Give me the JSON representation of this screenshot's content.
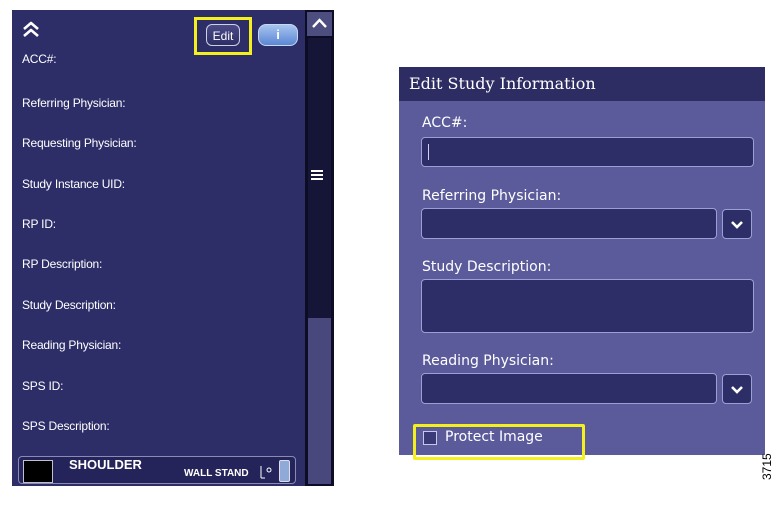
{
  "left_panel": {
    "edit_label": "Edit",
    "info_label": "i",
    "fields": [
      "ACC#:",
      "Referring Physician:",
      "Requesting Physician:",
      "Study Instance UID:",
      "RP ID:",
      "RP Description:",
      "Study Description:",
      "Reading Physician:",
      "SPS ID:",
      "SPS Description:"
    ],
    "thumbnail": {
      "title": "SHOULDER",
      "subtitle": "WALL STAND"
    }
  },
  "dialog": {
    "title": "Edit Study Information",
    "acc_label": "ACC#:",
    "acc_value": "",
    "referring_label": "Referring Physician:",
    "referring_value": "",
    "study_desc_label": "Study Description:",
    "study_desc_value": "",
    "reading_label": "Reading Physician:",
    "reading_value": "",
    "protect_label": "Protect Image",
    "protect_checked": false
  },
  "figure_number": "3715",
  "colors": {
    "panel_bg": "#2d2d68",
    "dialog_bg": "#5b5a9b",
    "highlight": "#f4ef1e",
    "info_button": "#7aa2e6"
  },
  "icons": {
    "collapse": "double-chevron-up-icon",
    "scroll_up": "chevron-up-icon",
    "scroll_handle": "hamburger-icon",
    "dropdown": "chevron-down-icon"
  }
}
